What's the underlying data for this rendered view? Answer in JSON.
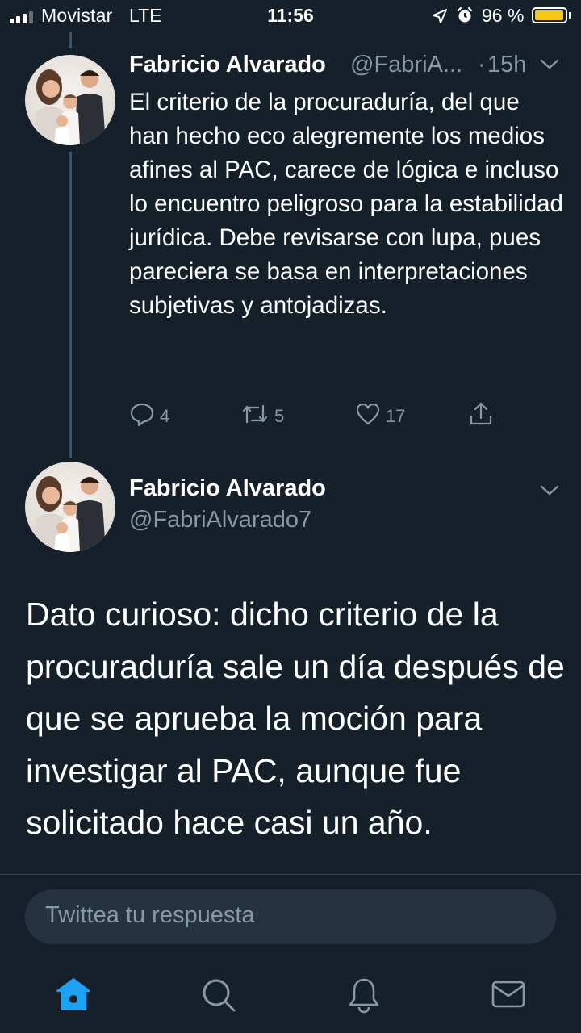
{
  "status_bar": {
    "carrier": "Movistar",
    "network": "LTE",
    "time": "11:56",
    "battery_percent": "96 %",
    "battery_level": 0.96,
    "icons": [
      "signal-icon",
      "location-arrow-icon",
      "alarm-icon",
      "battery-icon"
    ]
  },
  "tweet1": {
    "name": "Fabricio Alvarado",
    "handle": "@FabriA...",
    "separator": "·",
    "time": "15h",
    "text": "El criterio de la procuraduría, del que han hecho eco alegremente los medios afines al PAC, carece de lógica e incluso lo encuentro peligroso para la estabilidad jurídica. Debe revisarse con lupa, pues pareciera se basa en interpretaciones subjetivas y antojadizas.",
    "replies": "4",
    "retweets": "5",
    "likes": "17"
  },
  "tweet2": {
    "name": "Fabricio Alvarado",
    "handle": "@FabriAlvarado7",
    "text": "Dato curioso: dicho criterio de la procuraduría sale un día después de que se aprueba la moción para investigar al PAC, aunque fue solicitado hace casi un año."
  },
  "reply": {
    "placeholder": "Twittea tu respuesta"
  },
  "bottom_nav": [
    "home-icon",
    "search-icon",
    "notifications-icon",
    "messages-icon"
  ],
  "colors": {
    "background": "#15202b",
    "secondary_text": "#8899a6",
    "accent": "#1da1f2",
    "battery": "#f5c518"
  }
}
